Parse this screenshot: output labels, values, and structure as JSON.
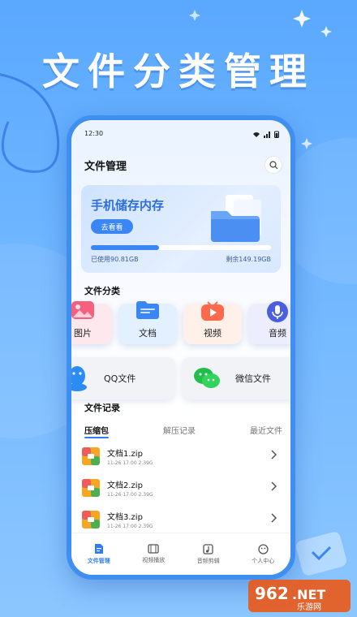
{
  "headline": "文件分类管理",
  "status": {
    "time": "12:30"
  },
  "app": {
    "title": "文件管理"
  },
  "storage": {
    "title": "手机储存内存",
    "button": "去看看",
    "used": "已使用90.81GB",
    "remaining": "剩余149.19GB",
    "used_fraction": 0.38
  },
  "categories": {
    "title": "文件分类",
    "items": [
      {
        "label": "图片",
        "icon": "image-icon",
        "bg": "#fde8ee",
        "color": "#f5607e"
      },
      {
        "label": "文档",
        "icon": "folder-icon",
        "bg": "#e3f0ff",
        "color": "#3b86f5"
      },
      {
        "label": "视频",
        "icon": "video-icon",
        "bg": "#fff0ea",
        "color": "#ff6a4d"
      },
      {
        "label": "音频",
        "icon": "microphone-icon",
        "bg": "#eceefe",
        "color": "#4a5ee0"
      }
    ]
  },
  "quick": [
    {
      "label": "QQ文件",
      "icon": "qq-icon"
    },
    {
      "label": "微信文件",
      "icon": "wechat-icon"
    }
  ],
  "records": {
    "title": "文件记录",
    "tabs": [
      "压缩包",
      "解压记录",
      "最近文件"
    ],
    "files": [
      {
        "name": "文档1.zip",
        "meta": "11-26 17:00  2.39G"
      },
      {
        "name": "文档2.zip",
        "meta": "11-26 17:00  2.39G"
      },
      {
        "name": "文档3.zip",
        "meta": "11-26 17:00  2.39G"
      }
    ]
  },
  "nav": [
    {
      "label": "文件管理",
      "icon": "file-icon",
      "active": true
    },
    {
      "label": "视频播放",
      "icon": "film-icon",
      "active": false
    },
    {
      "label": "音频剪辑",
      "icon": "music-icon",
      "active": false
    },
    {
      "label": "个人中心",
      "icon": "user-icon",
      "active": false
    }
  ],
  "watermark": {
    "number": "962",
    "suffix": ".NET",
    "site": "乐游网"
  },
  "colors": {
    "accent": "#3b86f5",
    "background": "#6fb6ff"
  }
}
